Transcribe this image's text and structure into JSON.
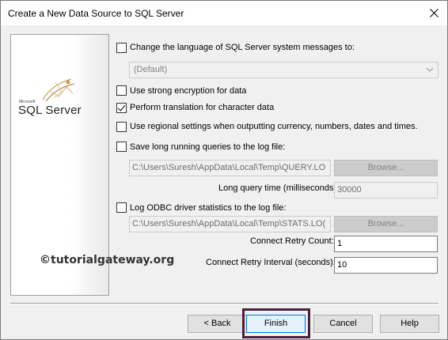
{
  "window": {
    "title": "Create a New Data Source to SQL Server"
  },
  "logo": {
    "small_text": "Microsoft",
    "main_text": "SQL Server"
  },
  "options": {
    "change_language_label": "Change the language of SQL Server system messages to:",
    "change_language_checked": false,
    "language_value": "(Default)",
    "strong_encryption_label": "Use strong encryption for data",
    "strong_encryption_checked": false,
    "translation_label": "Perform translation for character data",
    "translation_checked": true,
    "regional_label": "Use regional settings when outputting currency, numbers, dates and times.",
    "regional_checked": false,
    "long_queries_label": "Save long running queries to the log file:",
    "long_queries_checked": false,
    "long_queries_path": "C:\\Users\\Suresh\\AppData\\Local\\Temp\\QUERY.LO",
    "long_queries_browse": "Browse...",
    "long_query_time_label": "Long query time (milliseconds):",
    "long_query_time_value": "30000",
    "odbc_stats_label": "Log ODBC driver statistics to the log file:",
    "odbc_stats_checked": false,
    "odbc_stats_path": "C:\\Users\\Suresh\\AppData\\Local\\Temp\\STATS.LO(",
    "odbc_stats_browse": "Browse...",
    "retry_count_label": "Connect Retry Count:",
    "retry_count_value": "1",
    "retry_interval_label": "Connect Retry Interval (seconds):",
    "retry_interval_value": "10"
  },
  "watermark": "©tutorialgateway.org",
  "buttons": {
    "back": "< Back",
    "finish": "Finish",
    "cancel": "Cancel",
    "help": "Help"
  },
  "colors": {
    "window_bg": "#f0f0f0",
    "highlight_box": "#4b1f3f",
    "default_button_border": "#0078d7"
  }
}
